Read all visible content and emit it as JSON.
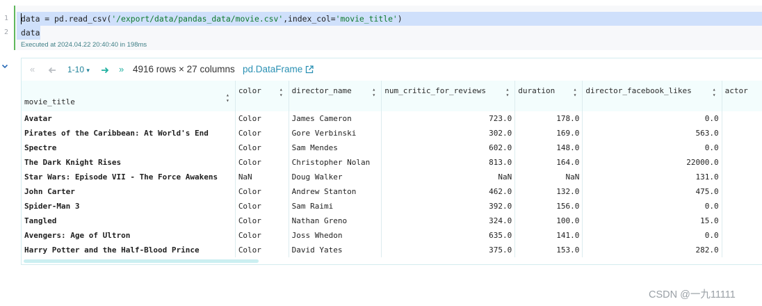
{
  "cell": {
    "line_numbers": [
      "1",
      "2"
    ],
    "code_line_1_prefix": "data = pd.read_csv(",
    "code_line_1_path": "'/export/data/pandas_data/movie.csv'",
    "code_line_1_mid": ",index_col=",
    "code_line_1_index": "'movie_title'",
    "code_line_1_suffix": ")",
    "code_line_2": "data",
    "exec_info": "Executed at 2024.04.22 20:40:40 in 198ms"
  },
  "output": {
    "page_range": "1-10",
    "rows_cols": "4916 rows × 27 columns",
    "type_link": "pd.DataFrame",
    "columns": [
      "movie_title",
      "color",
      "director_name",
      "num_critic_for_reviews",
      "duration",
      "director_facebook_likes",
      "actor"
    ],
    "rows": [
      {
        "movie_title": "Avatar",
        "color": "Color",
        "director_name": "James Cameron",
        "num_critic_for_reviews": "723.0",
        "duration": "178.0",
        "director_facebook_likes": "0.0"
      },
      {
        "movie_title": "Pirates of the Caribbean: At World's End",
        "color": "Color",
        "director_name": "Gore Verbinski",
        "num_critic_for_reviews": "302.0",
        "duration": "169.0",
        "director_facebook_likes": "563.0"
      },
      {
        "movie_title": "Spectre",
        "color": "Color",
        "director_name": "Sam Mendes",
        "num_critic_for_reviews": "602.0",
        "duration": "148.0",
        "director_facebook_likes": "0.0"
      },
      {
        "movie_title": "The Dark Knight Rises",
        "color": "Color",
        "director_name": "Christopher Nolan",
        "num_critic_for_reviews": "813.0",
        "duration": "164.0",
        "director_facebook_likes": "22000.0"
      },
      {
        "movie_title": "Star Wars: Episode VII - The Force Awakens",
        "color": "NaN",
        "director_name": "Doug Walker",
        "num_critic_for_reviews": "NaN",
        "duration": "NaN",
        "director_facebook_likes": "131.0"
      },
      {
        "movie_title": "John Carter",
        "color": "Color",
        "director_name": "Andrew Stanton",
        "num_critic_for_reviews": "462.0",
        "duration": "132.0",
        "director_facebook_likes": "475.0"
      },
      {
        "movie_title": "Spider-Man 3",
        "color": "Color",
        "director_name": "Sam Raimi",
        "num_critic_for_reviews": "392.0",
        "duration": "156.0",
        "director_facebook_likes": "0.0"
      },
      {
        "movie_title": "Tangled",
        "color": "Color",
        "director_name": "Nathan Greno",
        "num_critic_for_reviews": "324.0",
        "duration": "100.0",
        "director_facebook_likes": "15.0"
      },
      {
        "movie_title": "Avengers: Age of Ultron",
        "color": "Color",
        "director_name": "Joss Whedon",
        "num_critic_for_reviews": "635.0",
        "duration": "141.0",
        "director_facebook_likes": "0.0"
      },
      {
        "movie_title": "Harry Potter and the Half-Blood Prince",
        "color": "Color",
        "director_name": "David Yates",
        "num_critic_for_reviews": "375.0",
        "duration": "153.0",
        "director_facebook_likes": "282.0"
      }
    ]
  },
  "watermark": "CSDN @一九11111",
  "colors": {
    "gutter_accent": "#5fb85c",
    "selection": "#cfe0fb",
    "string": "#107a2e",
    "link": "#2a90b3",
    "header_bg": "#f3fdfd"
  }
}
